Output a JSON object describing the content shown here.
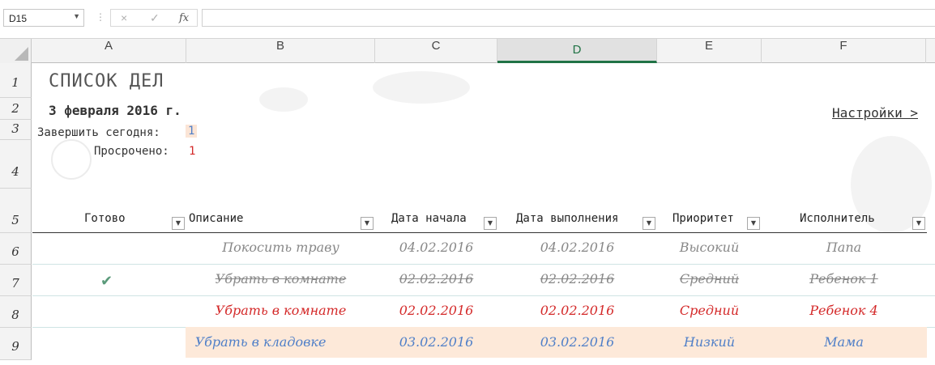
{
  "formula_bar": {
    "name_box": "D15",
    "cancel_icon": "×",
    "enter_icon": "✓",
    "fx_label": "fx",
    "formula": ""
  },
  "columns": [
    "A",
    "B",
    "C",
    "D",
    "E",
    "F"
  ],
  "selected_column": "D",
  "rows": [
    "1",
    "2",
    "3",
    "4",
    "5",
    "6",
    "7",
    "8",
    "9"
  ],
  "sheet": {
    "title": "СПИСОК ДЕЛ",
    "date": "3 февраля 2016 г.",
    "settings_link": "Настройки >",
    "due_today_label": "Завершить сегодня:",
    "due_today_value": "1",
    "overdue_label": "Просрочено:",
    "overdue_value": "1"
  },
  "table": {
    "headers": [
      "Готово",
      "Описание",
      "Дата начала",
      "Дата выполнения",
      "Приоритет",
      "Исполнитель"
    ],
    "rows": [
      {
        "done": "",
        "description": "Покосить траву",
        "start": "04.02.2016",
        "due": "04.02.2016",
        "priority": "Высокий",
        "assignee": "Папа"
      },
      {
        "done": "✔",
        "description": "Убрать в комнате",
        "start": "02.02.2016",
        "due": "02.02.2016",
        "priority": "Средний",
        "assignee": "Ребенок 1"
      },
      {
        "done": "",
        "description": "Убрать в комнате",
        "start": "02.02.2016",
        "due": "02.02.2016",
        "priority": "Средний",
        "assignee": "Ребенок 4"
      },
      {
        "done": "",
        "description": "Убрать в кладовке",
        "start": "03.02.2016",
        "due": "03.02.2016",
        "priority": "Низкий",
        "assignee": "Мама"
      }
    ]
  },
  "colors": {
    "accent": "#217346",
    "normal_text": "#888888",
    "overdue_text": "#d42a2a",
    "today_text": "#4f7fc8",
    "highlight": "#fde9d9"
  }
}
